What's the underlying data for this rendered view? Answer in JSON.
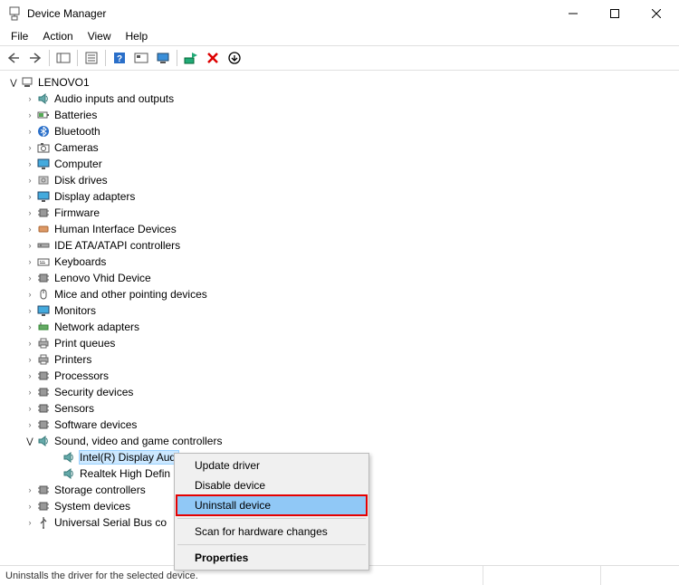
{
  "titlebar": {
    "title": "Device Manager"
  },
  "menubar": [
    "File",
    "Action",
    "View",
    "Help"
  ],
  "root": "LENOVO1",
  "categories": [
    "Audio inputs and outputs",
    "Batteries",
    "Bluetooth",
    "Cameras",
    "Computer",
    "Disk drives",
    "Display adapters",
    "Firmware",
    "Human Interface Devices",
    "IDE ATA/ATAPI controllers",
    "Keyboards",
    "Lenovo Vhid Device",
    "Mice and other pointing devices",
    "Monitors",
    "Network adapters",
    "Print queues",
    "Printers",
    "Processors",
    "Security devices",
    "Sensors",
    "Software devices",
    "Sound, video and game controllers",
    "Storage controllers",
    "System devices",
    "Universal Serial Bus co"
  ],
  "sound_children": [
    "Intel(R) Display Audi",
    "Realtek High Defin"
  ],
  "context_menu": {
    "items": [
      "Update driver",
      "Disable device",
      "Uninstall device",
      "Scan for hardware changes",
      "Properties"
    ]
  },
  "statusbar": {
    "text": "Uninstalls the driver for the selected device."
  },
  "icons": {
    "audio": "speaker",
    "batteries": "battery",
    "bluetooth": "bt",
    "cameras": "camera",
    "computer": "monitor",
    "disk": "disk",
    "display": "monitor",
    "firmware": "chip",
    "hid": "hid",
    "ide": "ide",
    "keyboards": "keyboard",
    "lenovo": "chip",
    "mice": "mouse",
    "monitors": "monitor",
    "network": "net",
    "printq": "printer",
    "printers": "printer",
    "processors": "chip",
    "security": "chip",
    "sensors": "chip",
    "software": "chip",
    "sound": "speaker",
    "storage": "chip",
    "system": "chip",
    "usb": "usb"
  }
}
